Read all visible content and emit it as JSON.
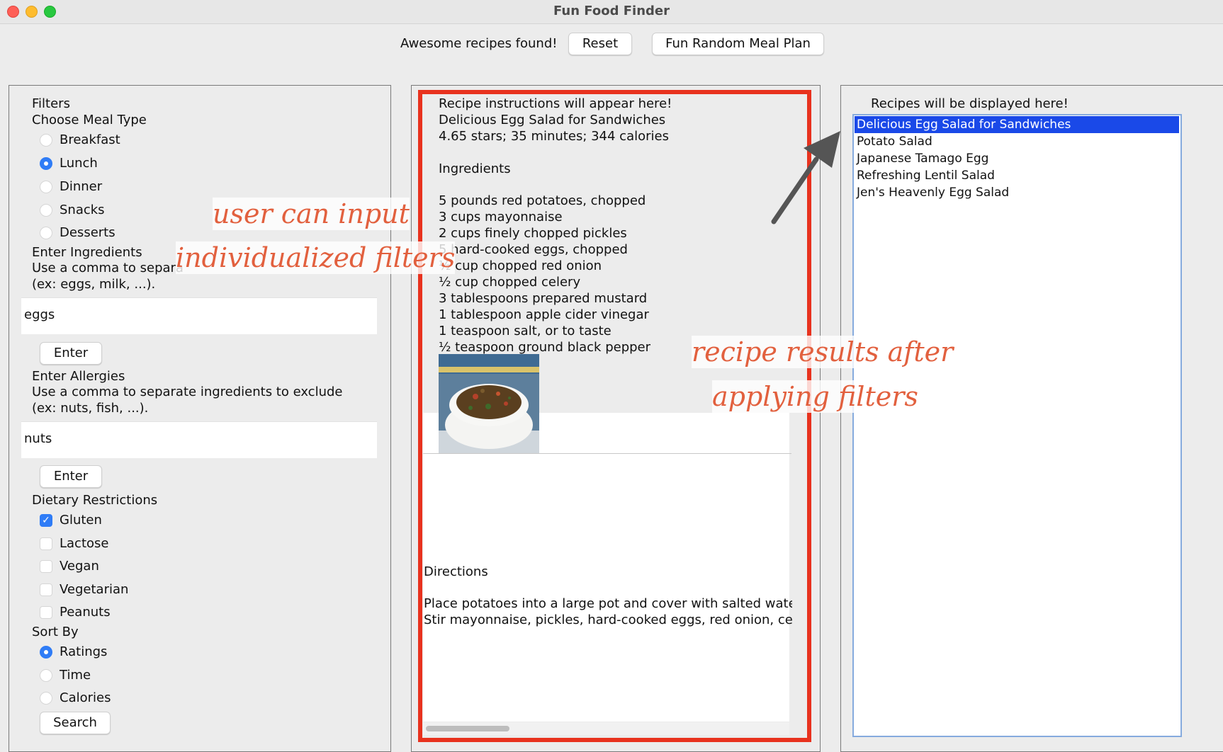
{
  "window": {
    "title": "Fun Food Finder"
  },
  "toolbar": {
    "status": "Awesome recipes found!",
    "reset_label": "Reset",
    "random_label": "Fun Random Meal Plan"
  },
  "filters": {
    "title": "Filters",
    "meal_type_label": "Choose Meal Type",
    "meal_types": [
      "Breakfast",
      "Lunch",
      "Dinner",
      "Snacks",
      "Desserts"
    ],
    "meal_type_selected": "Lunch",
    "ingredients_label": "Enter Ingredients",
    "ingredients_hint_1": "Use a comma to separa",
    "ingredients_hint_2": "(ex: eggs, milk, ...).",
    "ingredients_value": "eggs",
    "enter_label": "Enter",
    "allergies_label": "Enter Allergies",
    "allergies_hint_1": "Use a comma to separate ingredients to exclude",
    "allergies_hint_2": "(ex: nuts, fish, ...).",
    "allergies_value": "nuts",
    "dietary_label": "Dietary Restrictions",
    "dietary": [
      "Gluten",
      "Lactose",
      "Vegan",
      "Vegetarian",
      "Peanuts"
    ],
    "dietary_checked": [
      "Gluten"
    ],
    "sort_label": "Sort By",
    "sort_options": [
      "Ratings",
      "Time",
      "Calories"
    ],
    "sort_selected": "Ratings",
    "search_label": "Search"
  },
  "recipe": {
    "header": "Recipe instructions will appear here!",
    "name": "Delicious Egg Salad for Sandwiches",
    "meta": "4.65 stars; 35 minutes; 344 calories",
    "ingredients_title": "Ingredients",
    "ingredients": [
      "5 pounds red potatoes, chopped",
      "3 cups mayonnaise",
      "2 cups finely chopped pickles",
      "5 hard-cooked eggs, chopped",
      "½ cup chopped red onion",
      "½ cup chopped celery",
      "3 tablespoons prepared mustard",
      "1 tablespoon apple cider vinegar",
      "1 teaspoon salt, or to taste",
      "½ teaspoon ground black pepper"
    ],
    "directions_title": "Directions",
    "directions": [
      "Place potatoes into a large pot and cover with salted water",
      "Stir mayonnaise, pickles, hard-cooked eggs, red onion, ce"
    ]
  },
  "results": {
    "header": "Recipes will be displayed here!",
    "items": [
      "Delicious Egg Salad for Sandwiches",
      "Potato Salad",
      "Japanese Tamago Egg",
      "Refreshing Lentil Salad",
      "Jen's Heavenly Egg Salad"
    ],
    "selected": "Delicious Egg Salad for Sandwiches"
  },
  "annotations": {
    "filters_1": "user can input",
    "filters_2": "individualized filters",
    "results_1": "recipe results after",
    "results_2": "applying filters"
  },
  "colors": {
    "highlight_border": "#e8321e",
    "annotation": "#e2603e",
    "selection": "#1a49e8",
    "accent": "#2f7cf6"
  }
}
